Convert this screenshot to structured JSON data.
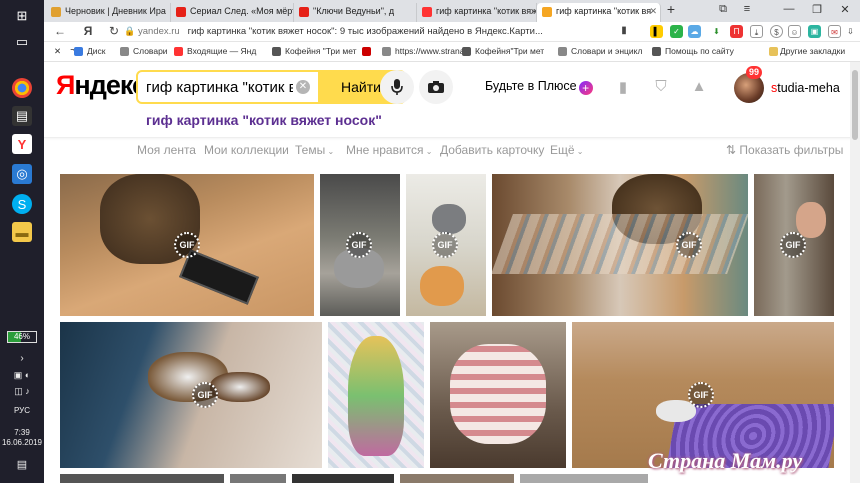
{
  "taskbar": {
    "battery": "46%",
    "lang": "РУС",
    "time": "7:39",
    "date": "16.06.2019"
  },
  "tabs": [
    {
      "label": "Черновик | Дневник Ира",
      "color": "#e0a030"
    },
    {
      "label": "Сериал След. «Моя мёртв",
      "color": "#e62117"
    },
    {
      "label": "\"Ключи Ведуньи\", д",
      "color": "#e62117"
    },
    {
      "label": "гиф картинка \"котик вяж",
      "color": "#f33"
    },
    {
      "label": "гиф картинка \"котик вя",
      "color": "#f5a623",
      "active": true
    }
  ],
  "address": {
    "domain": "yandex.ru",
    "title": "гиф картинка \"котик вяжет носок\": 9 тыс изображений найдено в Яндекс.Карти..."
  },
  "bookmarks": [
    {
      "label": "Диск",
      "color": "#3a7be0"
    },
    {
      "label": "Словари",
      "color": "#888"
    },
    {
      "label": "Входящие — Янд",
      "color": "#f33"
    },
    {
      "label": "Кофейня \"Три мет",
      "color": "#555"
    },
    {
      "label": "",
      "color": "#c00"
    },
    {
      "label": "https://www.strana",
      "color": "#888"
    },
    {
      "label": "Кофейня\"Три мет",
      "color": "#555"
    },
    {
      "label": "Словари и энцикл",
      "color": "#888"
    },
    {
      "label": "Помощь по сайту",
      "color": "#555"
    }
  ],
  "other_bookmarks": "Другие закладки",
  "header": {
    "logo_first": "Я",
    "logo_rest": "ндекс",
    "search_value": "гиф картинка \"котик вяжет носок\"",
    "find_label": "Найти",
    "query_link": "гиф картинка \"котик вяжет носок\"",
    "plus_label": "Будьте в Плюсе",
    "plus_badge": "+",
    "notif_count": "99",
    "user_first": "s",
    "user_rest": "tudia-meha"
  },
  "subnav": {
    "items": [
      "Моя лента",
      "Мои коллекции",
      "Темы",
      "Мне нравится",
      "Добавить карточку",
      "Ещё"
    ],
    "filters": "Показать фильтры"
  },
  "gif_label": "GIF",
  "watermark": "Страна Мам.ру"
}
